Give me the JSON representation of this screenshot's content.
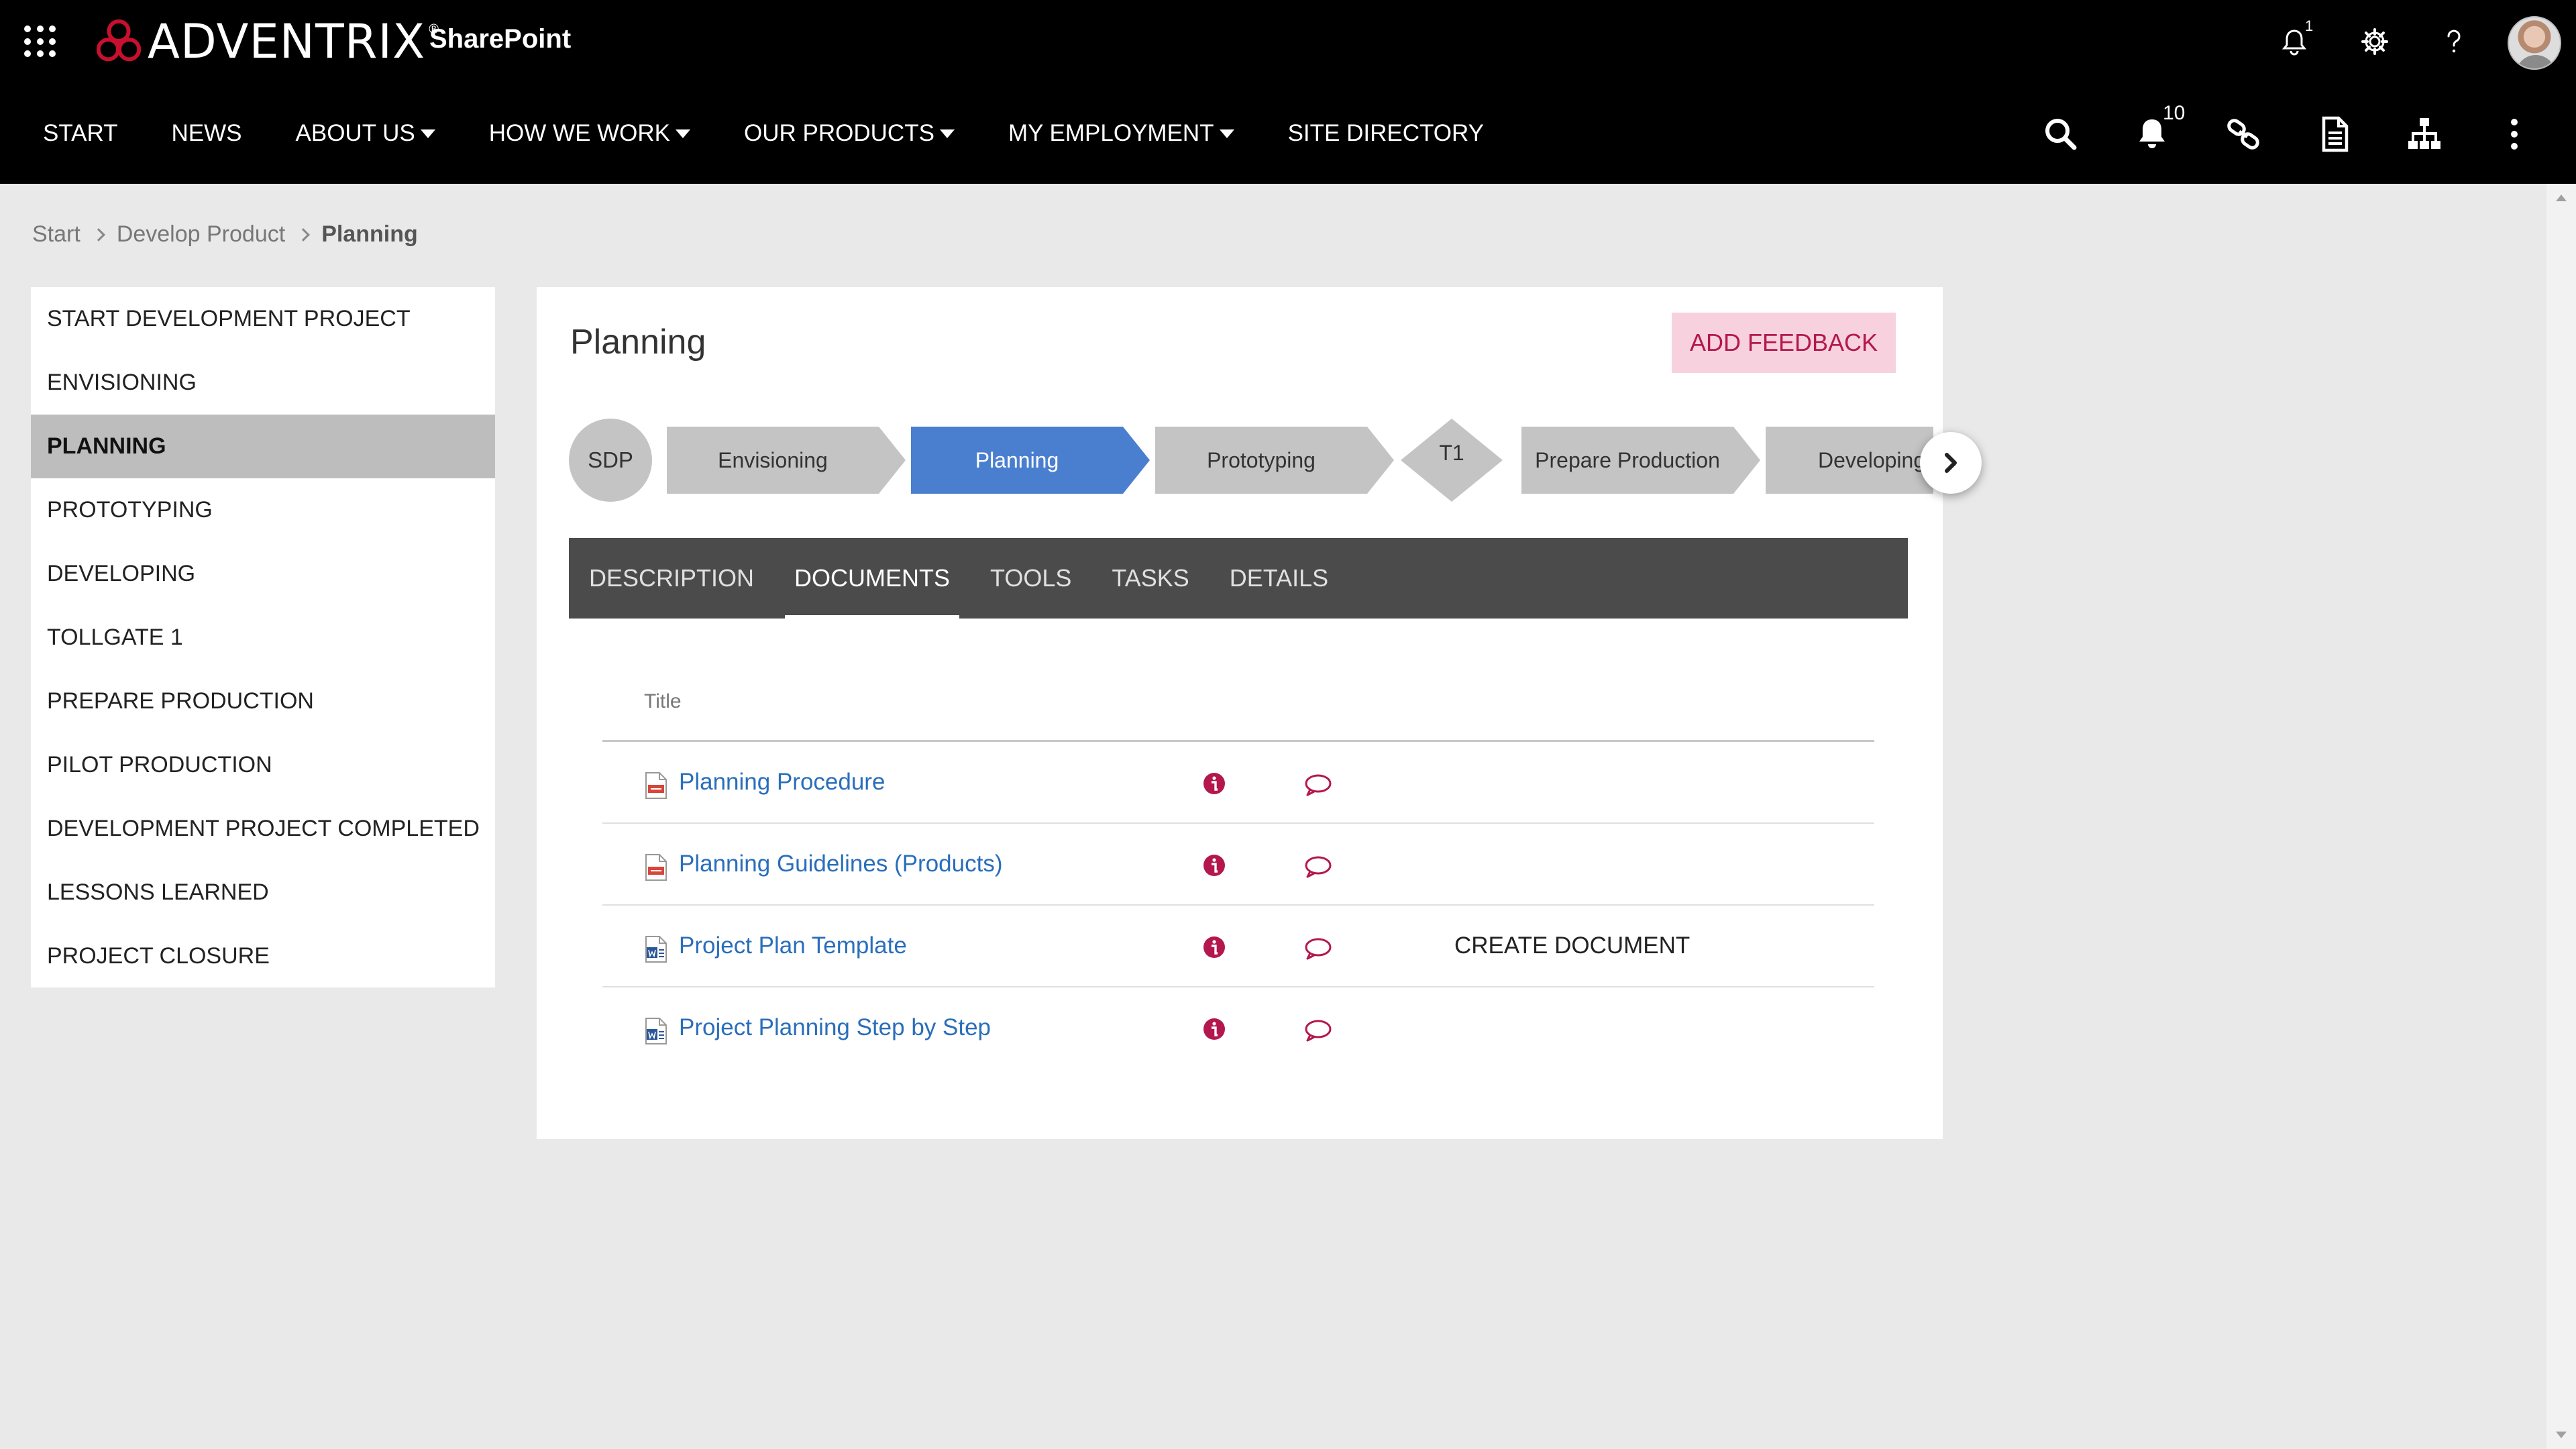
{
  "suite": {
    "brand": "ADVENTRIX",
    "brand_mark": "®",
    "app_title": "SharePoint",
    "notification_count": "1",
    "icons": [
      "waffle-icon",
      "bell-icon",
      "gear-icon",
      "help-icon"
    ]
  },
  "nav": {
    "items": [
      {
        "label": "START",
        "dropdown": false
      },
      {
        "label": "NEWS",
        "dropdown": false
      },
      {
        "label": "ABOUT US",
        "dropdown": true
      },
      {
        "label": "HOW WE WORK",
        "dropdown": true
      },
      {
        "label": "OUR PRODUCTS",
        "dropdown": true
      },
      {
        "label": "MY EMPLOYMENT",
        "dropdown": true
      },
      {
        "label": "SITE DIRECTORY",
        "dropdown": false
      }
    ],
    "alert_count": "10",
    "tools": [
      "search-icon",
      "bell-icon",
      "link-icon",
      "document-icon",
      "sitemap-icon",
      "more-icon"
    ]
  },
  "breadcrumb": {
    "items": [
      "Start",
      "Develop Product"
    ],
    "current": "Planning"
  },
  "sidenav": {
    "items": [
      {
        "label": "START DEVELOPMENT PROJECT",
        "active": false
      },
      {
        "label": "ENVISIONING",
        "active": false
      },
      {
        "label": "PLANNING",
        "active": true
      },
      {
        "label": "PROTOTYPING",
        "active": false
      },
      {
        "label": "DEVELOPING",
        "active": false
      },
      {
        "label": "TOLLGATE 1",
        "active": false
      },
      {
        "label": "PREPARE PRODUCTION",
        "active": false
      },
      {
        "label": "PILOT PRODUCTION",
        "active": false
      },
      {
        "label": "DEVELOPMENT PROJECT COMPLETED",
        "active": false
      },
      {
        "label": "LESSONS LEARNED",
        "active": false
      },
      {
        "label": "PROJECT CLOSURE",
        "active": false
      }
    ]
  },
  "main": {
    "title": "Planning",
    "feedback_label": "ADD FEEDBACK",
    "process": {
      "start": "SDP",
      "steps": [
        "Envisioning",
        "Planning",
        "Prototyping"
      ],
      "gate": "T1",
      "steps_after": [
        "Prepare Production",
        "Developing"
      ],
      "active": "Planning"
    },
    "tabs": [
      {
        "label": "DESCRIPTION",
        "active": false
      },
      {
        "label": "DOCUMENTS",
        "active": true
      },
      {
        "label": "TOOLS",
        "active": false
      },
      {
        "label": "TASKS",
        "active": false
      },
      {
        "label": "DETAILS",
        "active": false
      }
    ],
    "documents": {
      "column_title": "Title",
      "rows": [
        {
          "title": "Planning Procedure",
          "type": "pdf",
          "action": ""
        },
        {
          "title": "Planning Guidelines (Products)",
          "type": "pdf",
          "action": ""
        },
        {
          "title": "Project Plan Template",
          "type": "word",
          "action": "CREATE DOCUMENT"
        },
        {
          "title": "Project Planning Step by Step",
          "type": "word",
          "action": ""
        }
      ]
    }
  },
  "colors": {
    "bar_bg": "#000000",
    "accent": "#b4174d",
    "active_step": "#4a7fd0",
    "link": "#2a6ebb",
    "tab_bg": "#4b4b4b"
  }
}
